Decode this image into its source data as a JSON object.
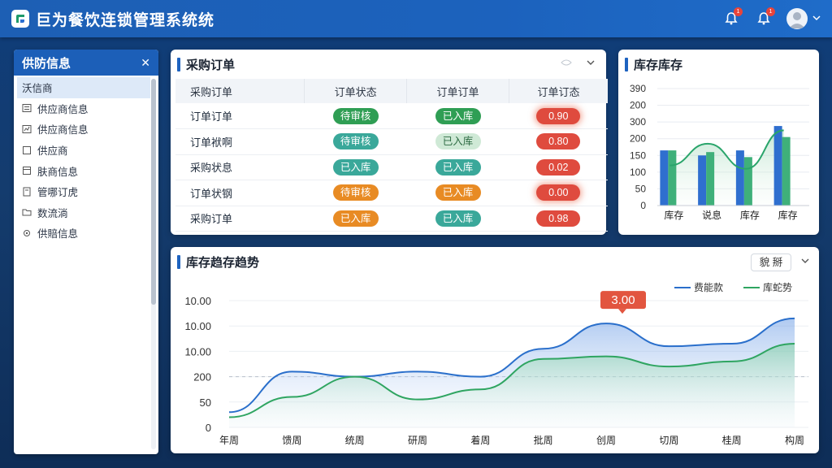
{
  "app": {
    "title": "巨为餐饮连锁管理系统统"
  },
  "header": {
    "badge1": "1",
    "badge2": "1"
  },
  "sidebar": {
    "title": "供防信息",
    "items": [
      {
        "label": "沃信商",
        "icon": "none"
      },
      {
        "label": "供应商信息",
        "icon": "list-icon"
      },
      {
        "label": "供应商信息",
        "icon": "chart-icon"
      },
      {
        "label": "供应商",
        "icon": "box-icon"
      },
      {
        "label": "肤商信息",
        "icon": "box-icon"
      },
      {
        "label": "管哪订虎",
        "icon": "doc-icon"
      },
      {
        "label": "数流淌",
        "icon": "folder-icon"
      },
      {
        "label": "供賠信息",
        "icon": "gear-icon"
      }
    ]
  },
  "orders": {
    "title": "采购订单",
    "columns": [
      "采购订单",
      "订单状态",
      "订单订单",
      "订单订态"
    ],
    "rows": [
      {
        "name": "订单订单",
        "status": "待审核",
        "status_color": "green",
        "state": "已入库",
        "state_color": "green",
        "value": "0.90",
        "glow": true
      },
      {
        "name": "订单袱啊",
        "status": "待审核",
        "status_color": "teal",
        "state": "已入库",
        "state_color": "lightgreen",
        "value": "0.80",
        "glow": false
      },
      {
        "name": "采购状息",
        "status": "已入库",
        "status_color": "teal",
        "state": "已入库",
        "state_color": "teal",
        "value": "0.02",
        "glow": false
      },
      {
        "name": "订单状钢",
        "status": "待审核",
        "status_color": "orange",
        "state": "已入库",
        "state_color": "orange",
        "value": "0.00",
        "glow": true
      },
      {
        "name": "采购订单",
        "status": "已入库",
        "status_color": "orange",
        "state": "已入库",
        "state_color": "teal",
        "value": "0.98",
        "glow": false
      }
    ]
  },
  "inventory": {
    "title": "库存库存"
  },
  "trend": {
    "title": "库存趋存趋势",
    "dropdown": "貌 掰",
    "callout": "3.00"
  },
  "chart_data": [
    {
      "type": "bar",
      "title": "库存库存",
      "categories": [
        "库存",
        "说息",
        "库存",
        "库存"
      ],
      "y_tick_labels": [
        "0",
        "50",
        "100",
        "150",
        "200",
        "300",
        "200",
        "390"
      ],
      "y_tick_values": [
        0,
        50,
        100,
        150,
        200,
        250,
        300,
        350
      ],
      "series": [
        {
          "values": [
            165,
            150,
            165,
            238
          ],
          "color": "#2f6fcf"
        },
        {
          "values": [
            165,
            160,
            145,
            205
          ],
          "color": "#3fb07a"
        }
      ],
      "line": {
        "values": [
          120,
          185,
          110,
          225
        ],
        "color": "#2aa56b"
      }
    },
    {
      "type": "area",
      "title": "库存趋存趋势",
      "categories": [
        "年周",
        "馈周",
        "统周",
        "研周",
        "着周",
        "批周",
        "创周",
        "切周",
        "桂周",
        "构周"
      ],
      "y_tick_labels": [
        "0",
        "50",
        "200",
        "10.00",
        "10.00",
        "10.00"
      ],
      "y_tick_values": [
        0,
        50,
        100,
        150,
        200,
        250
      ],
      "legend": [
        "费能款",
        "库蛇势"
      ],
      "legend_position": "top-right",
      "series": [
        {
          "name": "费能款",
          "color": "#2a6fcb",
          "values": [
            30,
            110,
            100,
            110,
            100,
            155,
            205,
            160,
            165,
            215
          ]
        },
        {
          "name": "库蛇势",
          "color": "#2fa561",
          "values": [
            20,
            60,
            100,
            55,
            75,
            135,
            140,
            120,
            130,
            165
          ]
        }
      ],
      "reference_line": 100
    }
  ]
}
